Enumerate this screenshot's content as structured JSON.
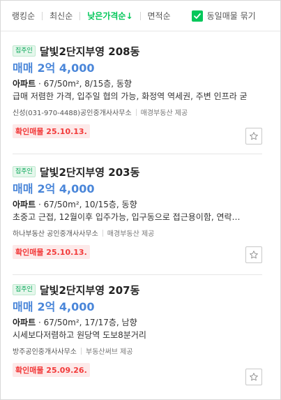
{
  "sort": {
    "options": [
      "랭킹순",
      "최신순",
      "낮은가격순↓",
      "면적순"
    ],
    "toggle_label": "동일매물 묶기"
  },
  "listings": [
    {
      "badge": "집주인",
      "title": "달빛2단지부영 208동",
      "deal_type": "매매",
      "price": "2억 4,000",
      "property_type": "아파트",
      "spec": " · 67/50m², 8/15층, 동향",
      "description": "급매 저렴한 가격, 입주일 협의 가능, 화정역 역세권, 주변 인프라 굳",
      "agent": "신성(031-970-4488)공인중개사사무소",
      "provider": "매경부동산 제공",
      "confirmed": "확인매물 25.10.13."
    },
    {
      "badge": "집주인",
      "title": "달빛2단지부영 203동",
      "deal_type": "매매",
      "price": "2억 4,000",
      "property_type": "아파트",
      "spec": " · 67/50m², 10/15층, 동향",
      "description": "초중고 근접, 12월이후 입주가능, 입구동으로 접근용이함, 연락…",
      "agent": "하나부동산 공인중개사사무소",
      "provider": "매경부동산 제공",
      "confirmed": "확인매물 25.10.13."
    },
    {
      "badge": "집주인",
      "title": "달빛2단지부영 207동",
      "deal_type": "매매",
      "price": "2억 4,000",
      "property_type": "아파트",
      "spec": " · 67/50m², 17/17층, 남향",
      "description": "시세보다저렴하고 원당역 도보8분거리",
      "agent": "방주공인중개사사무소",
      "provider": "부동산써브 제공",
      "confirmed": "확인매물 25.09.26."
    }
  ]
}
